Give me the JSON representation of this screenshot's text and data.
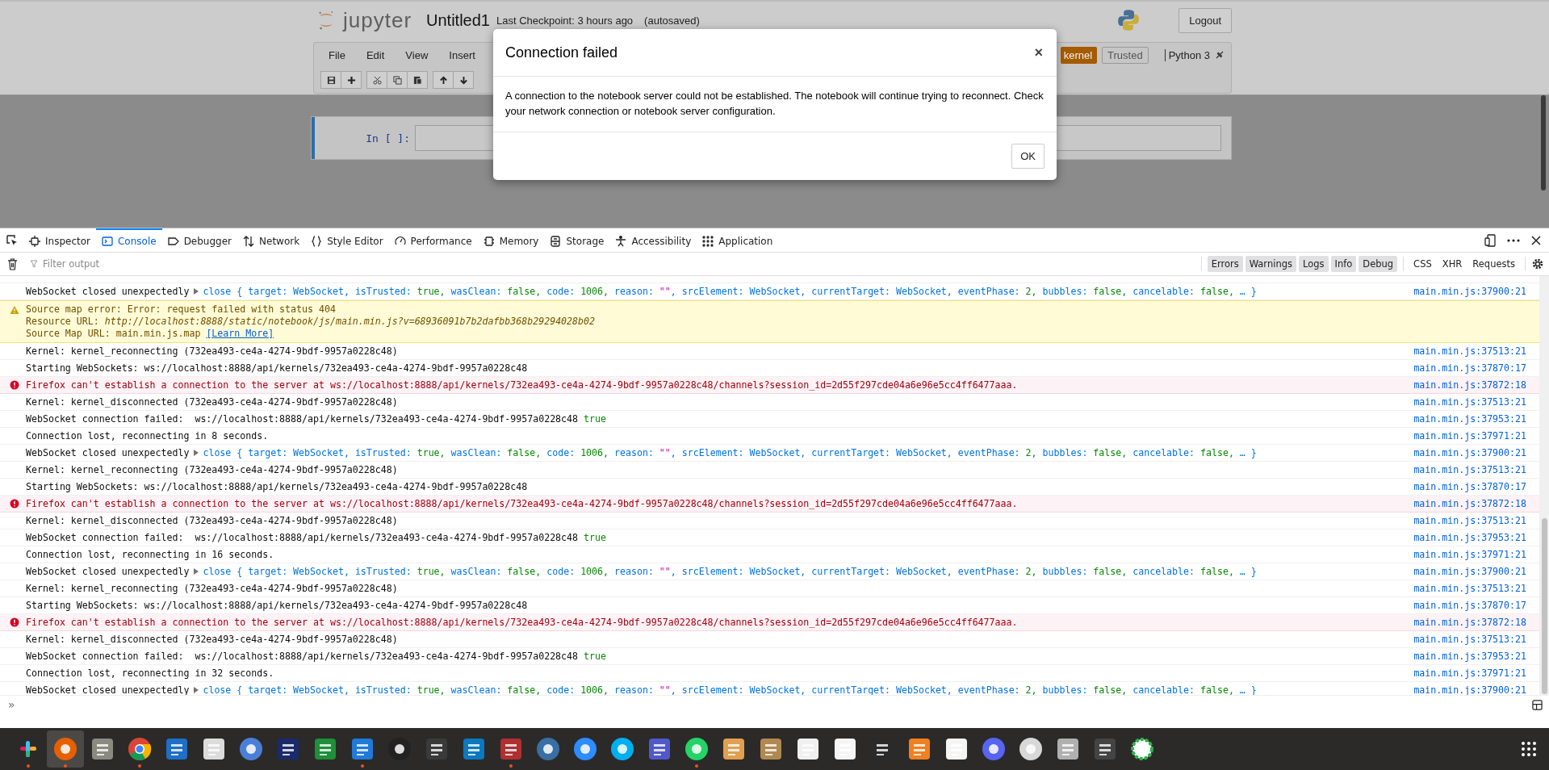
{
  "jupyter": {
    "logo_text": "jupyter",
    "notebook_name": "Untitled1",
    "checkpoint": "Last Checkpoint: 3 hours ago",
    "autosave": "(autosaved)",
    "logout": "Logout",
    "menu": [
      "File",
      "Edit",
      "View",
      "Insert"
    ],
    "kernel_badge": "kernel",
    "trusted": "Trusted",
    "kernel_name": "Python 3",
    "cell": {
      "prompt": "In [ ]:"
    }
  },
  "dialog": {
    "title": "Connection failed",
    "close": "×",
    "message": "A connection to the notebook server could not be established. The notebook will continue trying to reconnect. Check your network connection or notebook server configuration.",
    "button": "OK"
  },
  "devtools": {
    "tabs": [
      {
        "label": "Inspector",
        "selected": false
      },
      {
        "label": "Console",
        "selected": true
      },
      {
        "label": "Debugger",
        "selected": false
      },
      {
        "label": "Network",
        "selected": false
      },
      {
        "label": "Style Editor",
        "selected": false
      },
      {
        "label": "Performance",
        "selected": false
      },
      {
        "label": "Memory",
        "selected": false
      },
      {
        "label": "Storage",
        "selected": false
      },
      {
        "label": "Accessibility",
        "selected": false
      },
      {
        "label": "Application",
        "selected": false
      }
    ],
    "filter": {
      "placeholder": "Filter output"
    },
    "levels": [
      {
        "label": "Errors",
        "selected": true
      },
      {
        "label": "Warnings",
        "selected": true
      },
      {
        "label": "Logs",
        "selected": true
      },
      {
        "label": "Info",
        "selected": true
      },
      {
        "label": "Debug",
        "selected": true
      }
    ],
    "requests": [
      {
        "label": "CSS",
        "selected": false
      },
      {
        "label": "XHR",
        "selected": false
      },
      {
        "label": "Requests",
        "selected": false
      }
    ],
    "messages": [
      {
        "kind": "object",
        "text": "WebSocket closed unexpectedly",
        "preview": [
          {
            "kind": "obj",
            "text": "close { target: WebSocket, isTrusted: "
          },
          {
            "kind": "val",
            "text": "true,"
          },
          {
            "kind": "obj",
            "text": " wasClean: "
          },
          {
            "kind": "val",
            "text": "false,"
          },
          {
            "kind": "obj",
            "text": " code: "
          },
          {
            "kind": "val",
            "text": "1006,"
          },
          {
            "kind": "obj",
            "text": " reason: "
          },
          {
            "kind": "str",
            "text": "\"\""
          },
          {
            "kind": "obj",
            "text": ", srcElement: WebSocket, currentTarget: WebSocket, eventPhase: "
          },
          {
            "kind": "val",
            "text": "2,"
          },
          {
            "kind": "obj",
            "text": " bubbles: "
          },
          {
            "kind": "val",
            "text": "false,"
          },
          {
            "kind": "obj",
            "text": " cancelable: "
          },
          {
            "kind": "val",
            "text": "false,"
          },
          {
            "kind": "obj",
            "text": " … }"
          }
        ],
        "source": "main.min.js:37900:21"
      },
      {
        "kind": "warning",
        "lines": [
          "Source map error: Error: request failed with status 404",
          "Resource URL: *http://localhost:8888/static/notebook/js/main.min.js?v=68936091b7b2dafbb368b29294028b02*",
          "Source Map URL: main.min.js.map"
        ],
        "link": "[Learn More]"
      },
      {
        "kind": "log",
        "text": "Kernel: kernel_reconnecting (732ea493-ce4a-4274-9bdf-9957a0228c48)",
        "source": "main.min.js:37513:21"
      },
      {
        "kind": "log",
        "text": "Starting WebSockets: ws://localhost:8888/api/kernels/732ea493-ce4a-4274-9bdf-9957a0228c48",
        "source": "main.min.js:37870:17"
      },
      {
        "kind": "error",
        "text": "Firefox can't establish a connection to the server at ws://localhost:8888/api/kernels/732ea493-ce4a-4274-9bdf-9957a0228c48/channels?session_id=2d55f297cde04a6e96e5cc4ff6477aaa.",
        "source": "main.min.js:37872:18"
      },
      {
        "kind": "log",
        "text": "Kernel: kernel_disconnected (732ea493-ce4a-4274-9bdf-9957a0228c48)",
        "source": "main.min.js:37513:21"
      },
      {
        "kind": "result",
        "text": "WebSocket connection failed:  ws://localhost:8888/api/kernels/732ea493-ce4a-4274-9bdf-9957a0228c48",
        "value": "true",
        "source": "main.min.js:37953:21"
      },
      {
        "kind": "log",
        "text": "Connection lost, reconnecting in 8 seconds.",
        "source": "main.min.js:37971:21"
      },
      {
        "kind": "object",
        "text": "WebSocket closed unexpectedly",
        "preview": [
          {
            "kind": "obj",
            "text": "close { target: WebSocket, isTrusted: "
          },
          {
            "kind": "val",
            "text": "true,"
          },
          {
            "kind": "obj",
            "text": " wasClean: "
          },
          {
            "kind": "val",
            "text": "false,"
          },
          {
            "kind": "obj",
            "text": " code: "
          },
          {
            "kind": "val",
            "text": "1006,"
          },
          {
            "kind": "obj",
            "text": " reason: "
          },
          {
            "kind": "str",
            "text": "\"\""
          },
          {
            "kind": "obj",
            "text": ", srcElement: WebSocket, currentTarget: WebSocket, eventPhase: "
          },
          {
            "kind": "val",
            "text": "2,"
          },
          {
            "kind": "obj",
            "text": " bubbles: "
          },
          {
            "kind": "val",
            "text": "false,"
          },
          {
            "kind": "obj",
            "text": " cancelable: "
          },
          {
            "kind": "val",
            "text": "false,"
          },
          {
            "kind": "obj",
            "text": " … }"
          }
        ],
        "source": "main.min.js:37900:21"
      },
      {
        "kind": "log",
        "text": "Kernel: kernel_reconnecting (732ea493-ce4a-4274-9bdf-9957a0228c48)",
        "source": "main.min.js:37513:21"
      },
      {
        "kind": "log",
        "text": "Starting WebSockets: ws://localhost:8888/api/kernels/732ea493-ce4a-4274-9bdf-9957a0228c48",
        "source": "main.min.js:37870:17"
      },
      {
        "kind": "error",
        "text": "Firefox can't establish a connection to the server at ws://localhost:8888/api/kernels/732ea493-ce4a-4274-9bdf-9957a0228c48/channels?session_id=2d55f297cde04a6e96e5cc4ff6477aaa.",
        "source": "main.min.js:37872:18"
      },
      {
        "kind": "log",
        "text": "Kernel: kernel_disconnected (732ea493-ce4a-4274-9bdf-9957a0228c48)",
        "source": "main.min.js:37513:21"
      },
      {
        "kind": "result",
        "text": "WebSocket connection failed:  ws://localhost:8888/api/kernels/732ea493-ce4a-4274-9bdf-9957a0228c48",
        "value": "true",
        "source": "main.min.js:37953:21"
      },
      {
        "kind": "log",
        "text": "Connection lost, reconnecting in 16 seconds.",
        "source": "main.min.js:37971:21"
      },
      {
        "kind": "object",
        "text": "WebSocket closed unexpectedly",
        "preview": [
          {
            "kind": "obj",
            "text": "close { target: WebSocket, isTrusted: "
          },
          {
            "kind": "val",
            "text": "true,"
          },
          {
            "kind": "obj",
            "text": " wasClean: "
          },
          {
            "kind": "val",
            "text": "false,"
          },
          {
            "kind": "obj",
            "text": " code: "
          },
          {
            "kind": "val",
            "text": "1006,"
          },
          {
            "kind": "obj",
            "text": " reason: "
          },
          {
            "kind": "str",
            "text": "\"\""
          },
          {
            "kind": "obj",
            "text": ", srcElement: WebSocket, currentTarget: WebSocket, eventPhase: "
          },
          {
            "kind": "val",
            "text": "2,"
          },
          {
            "kind": "obj",
            "text": " bubbles: "
          },
          {
            "kind": "val",
            "text": "false,"
          },
          {
            "kind": "obj",
            "text": " cancelable: "
          },
          {
            "kind": "val",
            "text": "false,"
          },
          {
            "kind": "obj",
            "text": " … }"
          }
        ],
        "source": "main.min.js:37900:21"
      },
      {
        "kind": "log",
        "text": "Kernel: kernel_reconnecting (732ea493-ce4a-4274-9bdf-9957a0228c48)",
        "source": "main.min.js:37513:21"
      },
      {
        "kind": "log",
        "text": "Starting WebSockets: ws://localhost:8888/api/kernels/732ea493-ce4a-4274-9bdf-9957a0228c48",
        "source": "main.min.js:37870:17"
      },
      {
        "kind": "error",
        "text": "Firefox can't establish a connection to the server at ws://localhost:8888/api/kernels/732ea493-ce4a-4274-9bdf-9957a0228c48/channels?session_id=2d55f297cde04a6e96e5cc4ff6477aaa.",
        "source": "main.min.js:37872:18"
      },
      {
        "kind": "log",
        "text": "Kernel: kernel_disconnected (732ea493-ce4a-4274-9bdf-9957a0228c48)",
        "source": "main.min.js:37513:21"
      },
      {
        "kind": "result",
        "text": "WebSocket connection failed:  ws://localhost:8888/api/kernels/732ea493-ce4a-4274-9bdf-9957a0228c48",
        "value": "true",
        "source": "main.min.js:37953:21"
      },
      {
        "kind": "log",
        "text": "Connection lost, reconnecting in 32 seconds.",
        "source": "main.min.js:37971:21"
      },
      {
        "kind": "object",
        "text": "WebSocket closed unexpectedly",
        "preview": [
          {
            "kind": "obj",
            "text": "close { target: WebSocket, isTrusted: "
          },
          {
            "kind": "val",
            "text": "true,"
          },
          {
            "kind": "obj",
            "text": " wasClean: "
          },
          {
            "kind": "val",
            "text": "false,"
          },
          {
            "kind": "obj",
            "text": " code: "
          },
          {
            "kind": "val",
            "text": "1006,"
          },
          {
            "kind": "obj",
            "text": " reason: "
          },
          {
            "kind": "str",
            "text": "\"\""
          },
          {
            "kind": "obj",
            "text": ", srcElement: WebSocket, currentTarget: WebSocket, eventPhase: "
          },
          {
            "kind": "val",
            "text": "2,"
          },
          {
            "kind": "obj",
            "text": " bubbles: "
          },
          {
            "kind": "val",
            "text": "false,"
          },
          {
            "kind": "obj",
            "text": " cancelable: "
          },
          {
            "kind": "val",
            "text": "false,"
          },
          {
            "kind": "obj",
            "text": " … }"
          }
        ],
        "source": "main.min.js:37900:21"
      }
    ],
    "prompt": "»"
  },
  "taskbar": {
    "apps": [
      {
        "running": true,
        "selected": false
      },
      {
        "running": true,
        "selected": true
      },
      {
        "running": false,
        "selected": false
      },
      {
        "running": true,
        "selected": false
      },
      {
        "running": false,
        "selected": false
      },
      {
        "running": false,
        "selected": false
      },
      {
        "running": false,
        "selected": false
      },
      {
        "running": false,
        "selected": false
      },
      {
        "running": false,
        "selected": false
      },
      {
        "running": true,
        "selected": false
      },
      {
        "running": false,
        "selected": false
      },
      {
        "running": false,
        "selected": false
      },
      {
        "running": false,
        "selected": false
      },
      {
        "running": true,
        "selected": false
      },
      {
        "running": false,
        "selected": false
      },
      {
        "running": false,
        "selected": false
      },
      {
        "running": false,
        "selected": false
      },
      {
        "running": false,
        "selected": false
      },
      {
        "running": true,
        "selected": false
      },
      {
        "running": false,
        "selected": false
      },
      {
        "running": false,
        "selected": false
      },
      {
        "running": false,
        "selected": false
      },
      {
        "running": false,
        "selected": false
      },
      {
        "running": false,
        "selected": false
      },
      {
        "running": false,
        "selected": false
      },
      {
        "running": false,
        "selected": false
      },
      {
        "running": false,
        "selected": false
      },
      {
        "running": false,
        "selected": false
      },
      {
        "running": false,
        "selected": false
      },
      {
        "running": false,
        "selected": false
      },
      {
        "running": false,
        "selected": false
      }
    ]
  }
}
